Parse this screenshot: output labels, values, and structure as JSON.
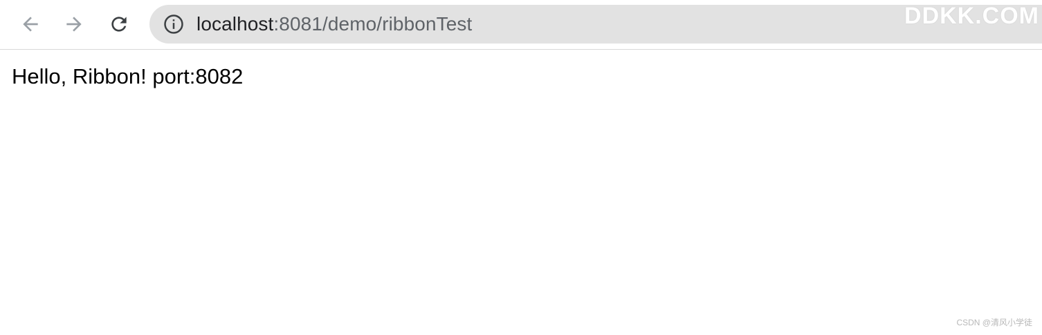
{
  "browser": {
    "nav": {
      "back_icon": "arrow-left-icon",
      "forward_icon": "arrow-right-icon",
      "reload_icon": "reload-icon"
    },
    "omnibox": {
      "info_icon": "info-circle-icon",
      "url_host": "localhost",
      "url_path": ":8081/demo/ribbonTest"
    }
  },
  "watermark": {
    "top": "DDKK.COM",
    "bottom": "CSDN @清风小学徒"
  },
  "page": {
    "body_text": "Hello, Ribbon! port:8082"
  },
  "colors": {
    "omnibox_bg": "#e2e2e2",
    "nav_disabled": "#9aa0a6",
    "nav_enabled": "#3c4043"
  }
}
